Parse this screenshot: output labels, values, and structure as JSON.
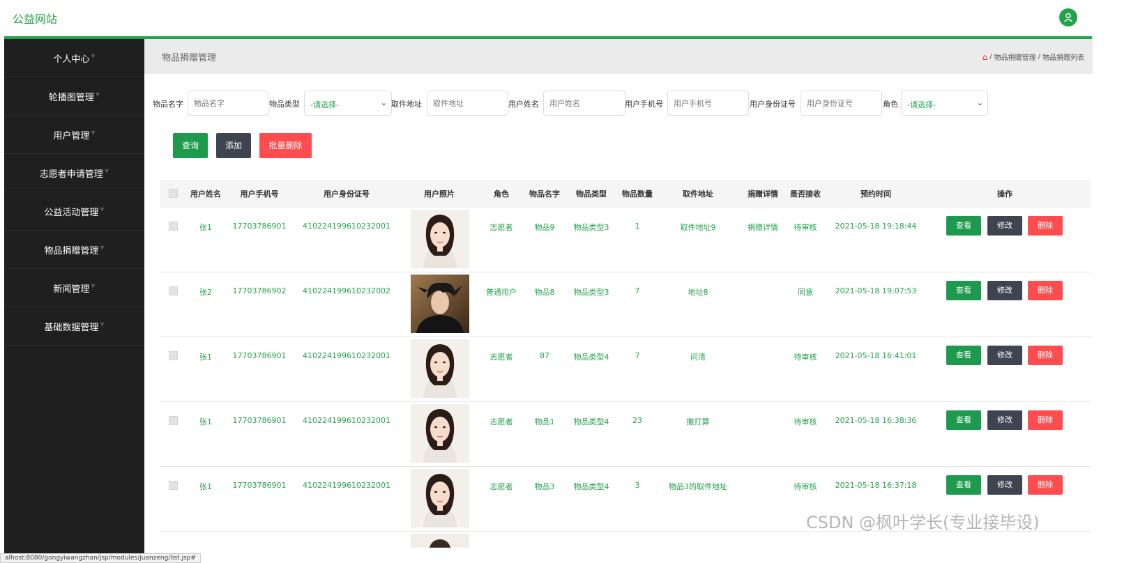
{
  "app": {
    "brand": "公益网站"
  },
  "sidebar": {
    "items": [
      {
        "label": "个人中心"
      },
      {
        "label": "轮播图管理"
      },
      {
        "label": "用户管理"
      },
      {
        "label": "志愿者申请管理"
      },
      {
        "label": "公益活动管理"
      },
      {
        "label": "物品捐赠管理"
      },
      {
        "label": "新闻管理"
      },
      {
        "label": "基础数据管理"
      }
    ]
  },
  "header": {
    "title": "物品捐赠管理",
    "breadcrumb": [
      "物品捐赠管理",
      "物品捐赠列表"
    ],
    "separator": "/"
  },
  "filters": {
    "item_name": {
      "label": "物品名字",
      "placeholder": "物品名字"
    },
    "item_type": {
      "label": "物品类型",
      "value": "-请选择-"
    },
    "address": {
      "label": "取件地址",
      "placeholder": "取件地址"
    },
    "user_name": {
      "label": "用户姓名",
      "placeholder": "用户姓名"
    },
    "phone": {
      "label": "用户手机号",
      "placeholder": "用户手机号"
    },
    "id_card": {
      "label": "用户身份证号",
      "placeholder": "用户身份证号"
    },
    "role": {
      "label": "角色",
      "value": "-请选择-"
    }
  },
  "actions": {
    "search": "查询",
    "add": "添加",
    "batch_delete": "批量删除"
  },
  "table": {
    "columns": [
      "用户姓名",
      "用户手机号",
      "用户身份证号",
      "用户照片",
      "角色",
      "物品名字",
      "物品类型",
      "物品数量",
      "取件地址",
      "捐赠详情",
      "是否接收",
      "预约时间",
      "操作"
    ],
    "rows": [
      {
        "name": "张1",
        "phone": "17703786901",
        "id": "410224199610232001",
        "role": "志愿者",
        "item": "物品9",
        "type": "物品类型3",
        "qty": "1",
        "addr": "取件地址9",
        "detail": "捐赠详情",
        "status": "待审核",
        "time": "2021-05-18 19:18:44",
        "photo": "female"
      },
      {
        "name": "张2",
        "phone": "17703786902",
        "id": "410224199610232002",
        "role": "普通用户",
        "item": "物品8",
        "type": "物品类型3",
        "qty": "7",
        "addr": "地址8",
        "detail": "",
        "status": "同意",
        "time": "2021-05-18 19:07:53",
        "photo": "male"
      },
      {
        "name": "张1",
        "phone": "17703786901",
        "id": "410224199610232001",
        "role": "志愿者",
        "item": "87",
        "type": "物品类型4",
        "qty": "7",
        "addr": "问清",
        "detail": "",
        "status": "待审核",
        "time": "2021-05-18 16:41:01",
        "photo": "female"
      },
      {
        "name": "张1",
        "phone": "17703786901",
        "id": "410224199610232001",
        "role": "志愿者",
        "item": "物品1",
        "type": "物品类型4",
        "qty": "23",
        "addr": "撒打算",
        "detail": "",
        "status": "待审核",
        "time": "2021-05-18 16:38:36",
        "photo": "female"
      },
      {
        "name": "张1",
        "phone": "17703786901",
        "id": "410224199610232001",
        "role": "志愿者",
        "item": "物品3",
        "type": "物品类型4",
        "qty": "3",
        "addr": "物品3的取件地址",
        "detail": "",
        "status": "待审核",
        "time": "2021-05-18 16:37:18",
        "photo": "female"
      }
    ],
    "row_actions": {
      "view": "查看",
      "edit": "修改",
      "delete": "删除"
    }
  },
  "watermark": "CSDN @枫叶学长(专业接毕设)",
  "statusbar": "alhost:8080/gongyiwangzhan/jsp/modules/juanzeng/list.jsp#",
  "colors": {
    "primary": "#22a34a",
    "dark": "#1f1f1f",
    "danger": "#ff4d4f",
    "slate": "#3e4450"
  },
  "icons": {
    "user": "user-icon",
    "home": "home-icon",
    "dropdown": "chevron-down-icon"
  }
}
